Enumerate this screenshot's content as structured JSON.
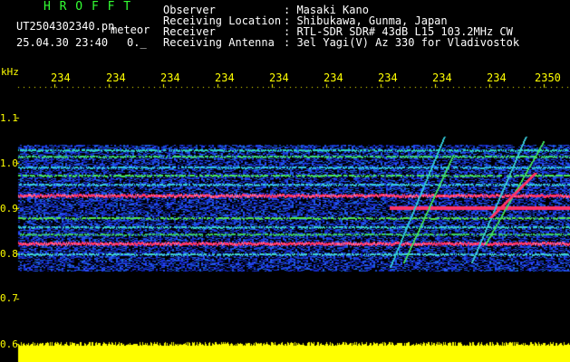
{
  "header": {
    "app_name": "H R O F F T",
    "filename": "UT2504302340.pn",
    "tag": "meteor",
    "datetime": "25.04.30 23:40",
    "counter": "0._",
    "fields": [
      {
        "label": "Observer",
        "value": ": Masaki Kano"
      },
      {
        "label": "Receiving Location",
        "value": ": Shibukawa, Gunma, Japan"
      },
      {
        "label": "Receiver",
        "value": ": RTL-SDR SDR# 43dB L15 103.2MHz CW"
      },
      {
        "label": "Receiving Antenna",
        "value": ": 3el Yagi(V) Az 330 for Vladivostok"
      }
    ]
  },
  "axis": {
    "unit": "kHz",
    "freq_labels": [
      "1.1",
      "1.0",
      "0.9",
      "0.8",
      "0.7",
      "0.6"
    ],
    "time_labels": [
      "234",
      "234",
      "234",
      "234",
      "234",
      "234",
      "234",
      "234",
      "234",
      "2350"
    ]
  },
  "colors": {
    "background": "#000000",
    "text_header": "#ffffff",
    "text_axis": "#ffff00",
    "title_green": "#33ff33",
    "noise_blue": "#1a2fd0",
    "signal_red": "#ff3366",
    "level_yellow": "#ffff00"
  }
}
